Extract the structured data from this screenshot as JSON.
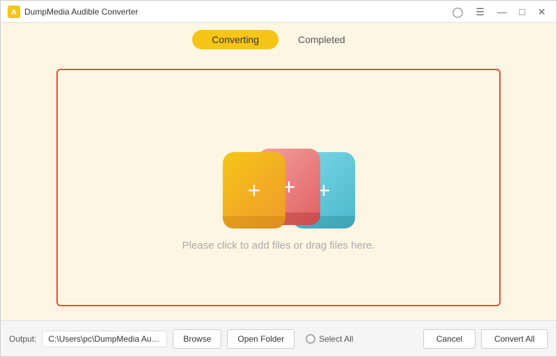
{
  "titleBar": {
    "appName": "DumpMedia Audible Converter",
    "controls": {
      "menu": "☰",
      "minimize": "—",
      "maximize": "□",
      "close": "✕"
    }
  },
  "tabs": {
    "converting": "Converting",
    "completed": "Completed"
  },
  "dropZone": {
    "hint": "Please click to add files or drag files here."
  },
  "bottomBar": {
    "outputLabel": "Output:",
    "outputPath": "C:\\Users\\pc\\DumpMedia AudioBook Converte",
    "browseLabel": "Browse",
    "openFolderLabel": "Open Folder",
    "selectAllLabel": "Select All",
    "cancelLabel": "Cancel",
    "convertAllLabel": "Convert All"
  }
}
